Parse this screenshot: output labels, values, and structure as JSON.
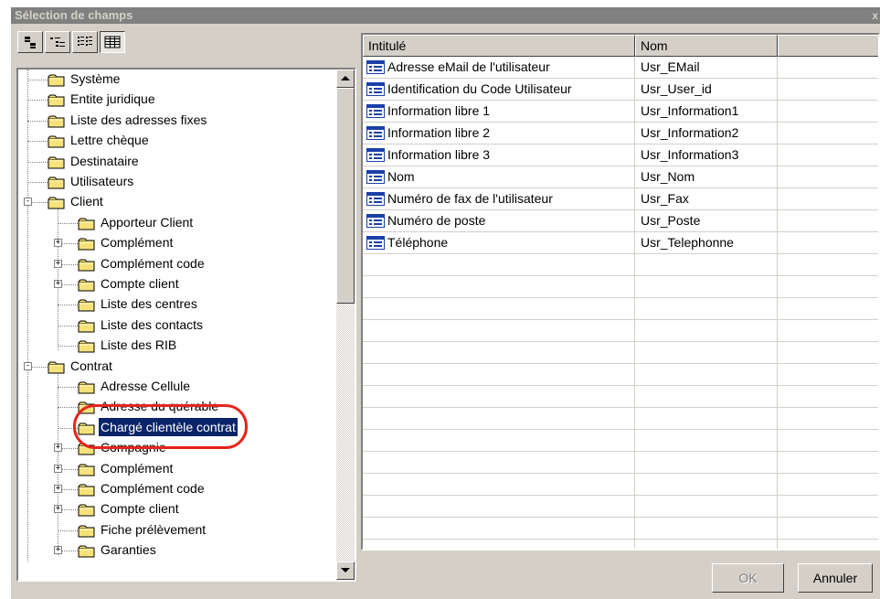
{
  "window": {
    "title": "Sélection de champs",
    "close_glyph": "x"
  },
  "toolbar": {
    "buttons": [
      {
        "name": "large-icons-view-button",
        "icon": "large-icons-icon"
      },
      {
        "name": "small-icons-view-button",
        "icon": "small-icons-icon"
      },
      {
        "name": "list-view-button",
        "icon": "list-view-icon"
      },
      {
        "name": "details-view-button",
        "icon": "details-view-icon",
        "pressed": true
      }
    ]
  },
  "tree": {
    "nodes": [
      {
        "label": "Système",
        "level": 0,
        "expander": ""
      },
      {
        "label": "Entite juridique",
        "level": 0,
        "expander": ""
      },
      {
        "label": "Liste des adresses fixes",
        "level": 0,
        "expander": ""
      },
      {
        "label": "Lettre chèque",
        "level": 0,
        "expander": ""
      },
      {
        "label": "Destinataire",
        "level": 0,
        "expander": ""
      },
      {
        "label": "Utilisateurs",
        "level": 0,
        "expander": ""
      },
      {
        "label": "Client",
        "level": 0,
        "expander": "-"
      },
      {
        "label": "Apporteur Client",
        "level": 1,
        "expander": ""
      },
      {
        "label": "Complément",
        "level": 1,
        "expander": "+"
      },
      {
        "label": "Complément code",
        "level": 1,
        "expander": "+"
      },
      {
        "label": "Compte client",
        "level": 1,
        "expander": "+"
      },
      {
        "label": "Liste des centres",
        "level": 1,
        "expander": ""
      },
      {
        "label": "Liste des contacts",
        "level": 1,
        "expander": ""
      },
      {
        "label": "Liste des RIB",
        "level": 1,
        "expander": ""
      },
      {
        "label": "Contrat",
        "level": 0,
        "expander": "-"
      },
      {
        "label": "Adresse Cellule",
        "level": 1,
        "expander": ""
      },
      {
        "label": "Adresse du quérable",
        "level": 1,
        "expander": ""
      },
      {
        "label": "Chargé clientèle contrat",
        "level": 1,
        "expander": "",
        "selected": true
      },
      {
        "label": "Compagnie",
        "level": 1,
        "expander": "+"
      },
      {
        "label": "Complément",
        "level": 1,
        "expander": "+"
      },
      {
        "label": "Complément code",
        "level": 1,
        "expander": "+"
      },
      {
        "label": "Compte client",
        "level": 1,
        "expander": "+"
      },
      {
        "label": "Fiche prélèvement",
        "level": 1,
        "expander": ""
      },
      {
        "label": "Garanties",
        "level": 1,
        "expander": "+"
      }
    ]
  },
  "grid": {
    "columns": [
      "Intitulé",
      "Nom",
      ""
    ],
    "rows": [
      {
        "intitule": "Adresse eMail de l'utilisateur",
        "nom": "Usr_EMail"
      },
      {
        "intitule": "Identification du Code Utilisateur",
        "nom": "Usr_User_id"
      },
      {
        "intitule": "Information libre 1",
        "nom": "Usr_Information1"
      },
      {
        "intitule": "Information libre 2",
        "nom": "Usr_Information2"
      },
      {
        "intitule": "Information libre 3",
        "nom": "Usr_Information3"
      },
      {
        "intitule": "Nom",
        "nom": "Usr_Nom"
      },
      {
        "intitule": "Numéro de fax de l'utilisateur",
        "nom": "Usr_Fax"
      },
      {
        "intitule": "Numéro de poste",
        "nom": "Usr_Poste"
      },
      {
        "intitule": "Téléphone",
        "nom": "Usr_Telephonne"
      }
    ],
    "empty_rows": 13
  },
  "buttons": {
    "ok": "OK",
    "cancel": "Annuler"
  },
  "colors": {
    "selection": "#0a246a",
    "annotation": "#e8241c",
    "face": "#d4d0c8"
  }
}
